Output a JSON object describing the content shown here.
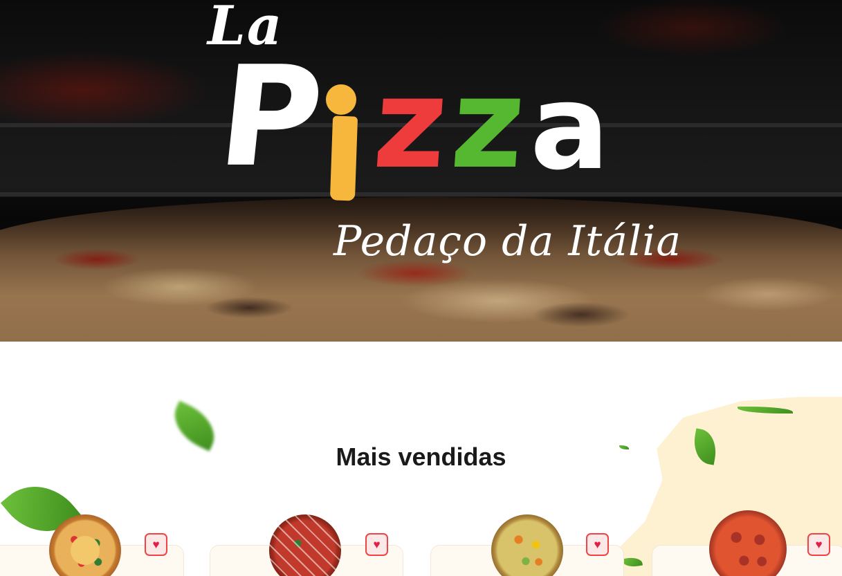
{
  "hero": {
    "logo": {
      "prefix": "La",
      "letters": [
        "P",
        "i",
        "z",
        "z",
        "a"
      ],
      "colors": {
        "p": "#ffffff",
        "i": "#f6b73c",
        "z1": "#ee3b3b",
        "z2": "#56b830",
        "a": "#ffffff"
      }
    },
    "tagline": "Pedaço da Itália"
  },
  "bestsellers": {
    "title": "Mais vendidas",
    "items": [
      {
        "image": "pizza-veggie",
        "favorite_icon": "heart-icon"
      },
      {
        "image": "pizza-pepperoni-drizzle",
        "favorite_icon": "heart-icon"
      },
      {
        "image": "pizza-pineapple-peppers",
        "favorite_icon": "heart-icon"
      },
      {
        "image": "pizza-pepperoni",
        "favorite_icon": "heart-icon"
      }
    ]
  },
  "colors": {
    "accent_red": "#ef4444",
    "card_bg": "#fffaf1",
    "cream": "#fdf0cf"
  }
}
